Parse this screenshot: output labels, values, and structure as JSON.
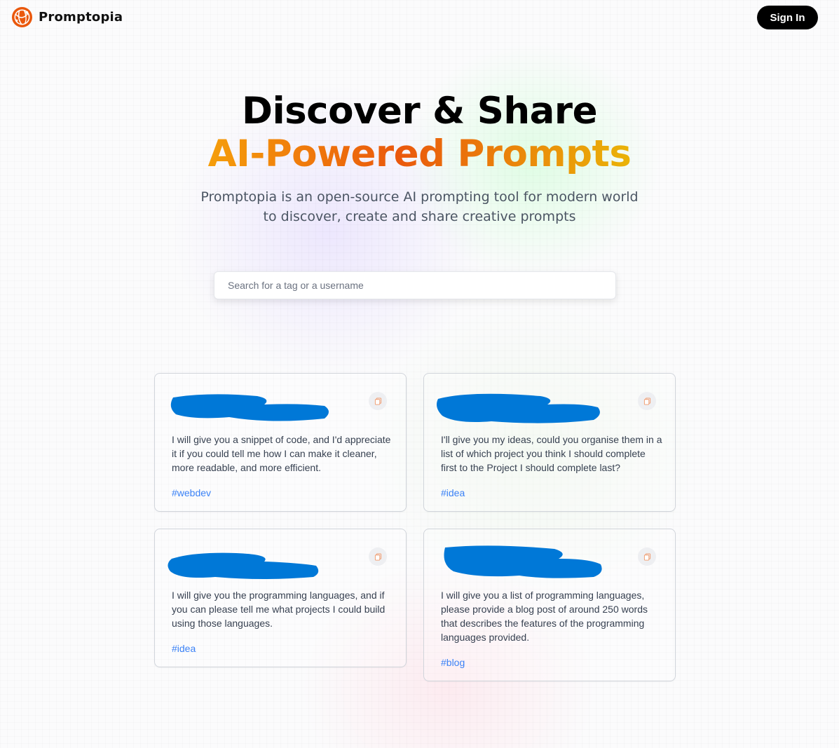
{
  "nav": {
    "brand": "Promptopia",
    "sign_in_label": "Sign In"
  },
  "hero": {
    "title_line1": "Discover & Share",
    "title_line2": "AI-Powered Prompts",
    "description": "Promptopia is an open-source AI prompting tool for modern world to discover, create and share creative prompts"
  },
  "search": {
    "placeholder": "Search for a tag or a username",
    "value": ""
  },
  "prompts": [
    {
      "text": "I will give you a snippet of code, and I'd appreciate it if you could tell me how I can make it cleaner, more readable, and more efficient.",
      "tag": "#webdev"
    },
    {
      "text": "I'll give you my ideas, could you organise them in a list of which project you think I should complete first to the Project I should complete last?",
      "tag": "#idea"
    },
    {
      "text": "I will give you the programming languages, and if you can please tell me what projects I could build using those languages.",
      "tag": "#idea"
    },
    {
      "text": "I will give you a list of programming languages, please provide a blog post of around 250 words that describes the features of the programming languages provided.",
      "tag": "#blog"
    }
  ],
  "colors": {
    "accent_orange": "#ea580c",
    "accent_amber": "#f59e0b",
    "tag_blue": "#3b82f6",
    "redaction_blue": "#0078d7"
  },
  "icons": {
    "logo": "globe-logo-icon",
    "copy": "copy-icon"
  }
}
